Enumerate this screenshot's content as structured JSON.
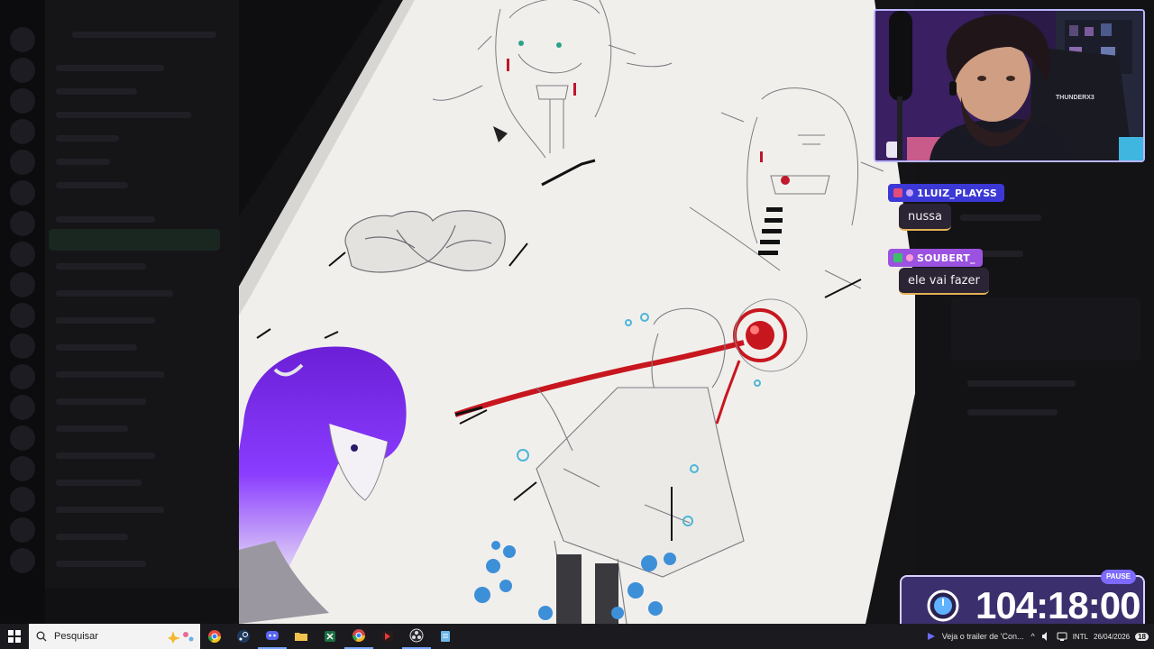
{
  "taskbar": {
    "search_placeholder": "Pesquisar",
    "news_text": "Veja o trailer de 'Con...",
    "tray_lang": "INTL",
    "tray_date": "26/04/2026",
    "notification_count": "18",
    "apps": [
      "chrome",
      "steam",
      "discord",
      "file-explorer",
      "excel",
      "chrome-beta",
      "music-app",
      "obs",
      "notepad"
    ]
  },
  "chat": {
    "messages": [
      {
        "user": "1LUIZ_PLAYSS",
        "text": "nussa",
        "name_color": "#3b38d6"
      },
      {
        "user": "SOUBERT_",
        "text": "ele vai fazer",
        "name_color": "#9b52e0"
      }
    ]
  },
  "timer": {
    "value": "104:18:00",
    "badge": "PAUSE"
  },
  "webcam": {
    "chair_brand": "THUNDERX3"
  },
  "colors": {
    "accent": "#6a4cff",
    "timer_bg": "#3b2f6d",
    "chat_border": "#e3b255"
  }
}
